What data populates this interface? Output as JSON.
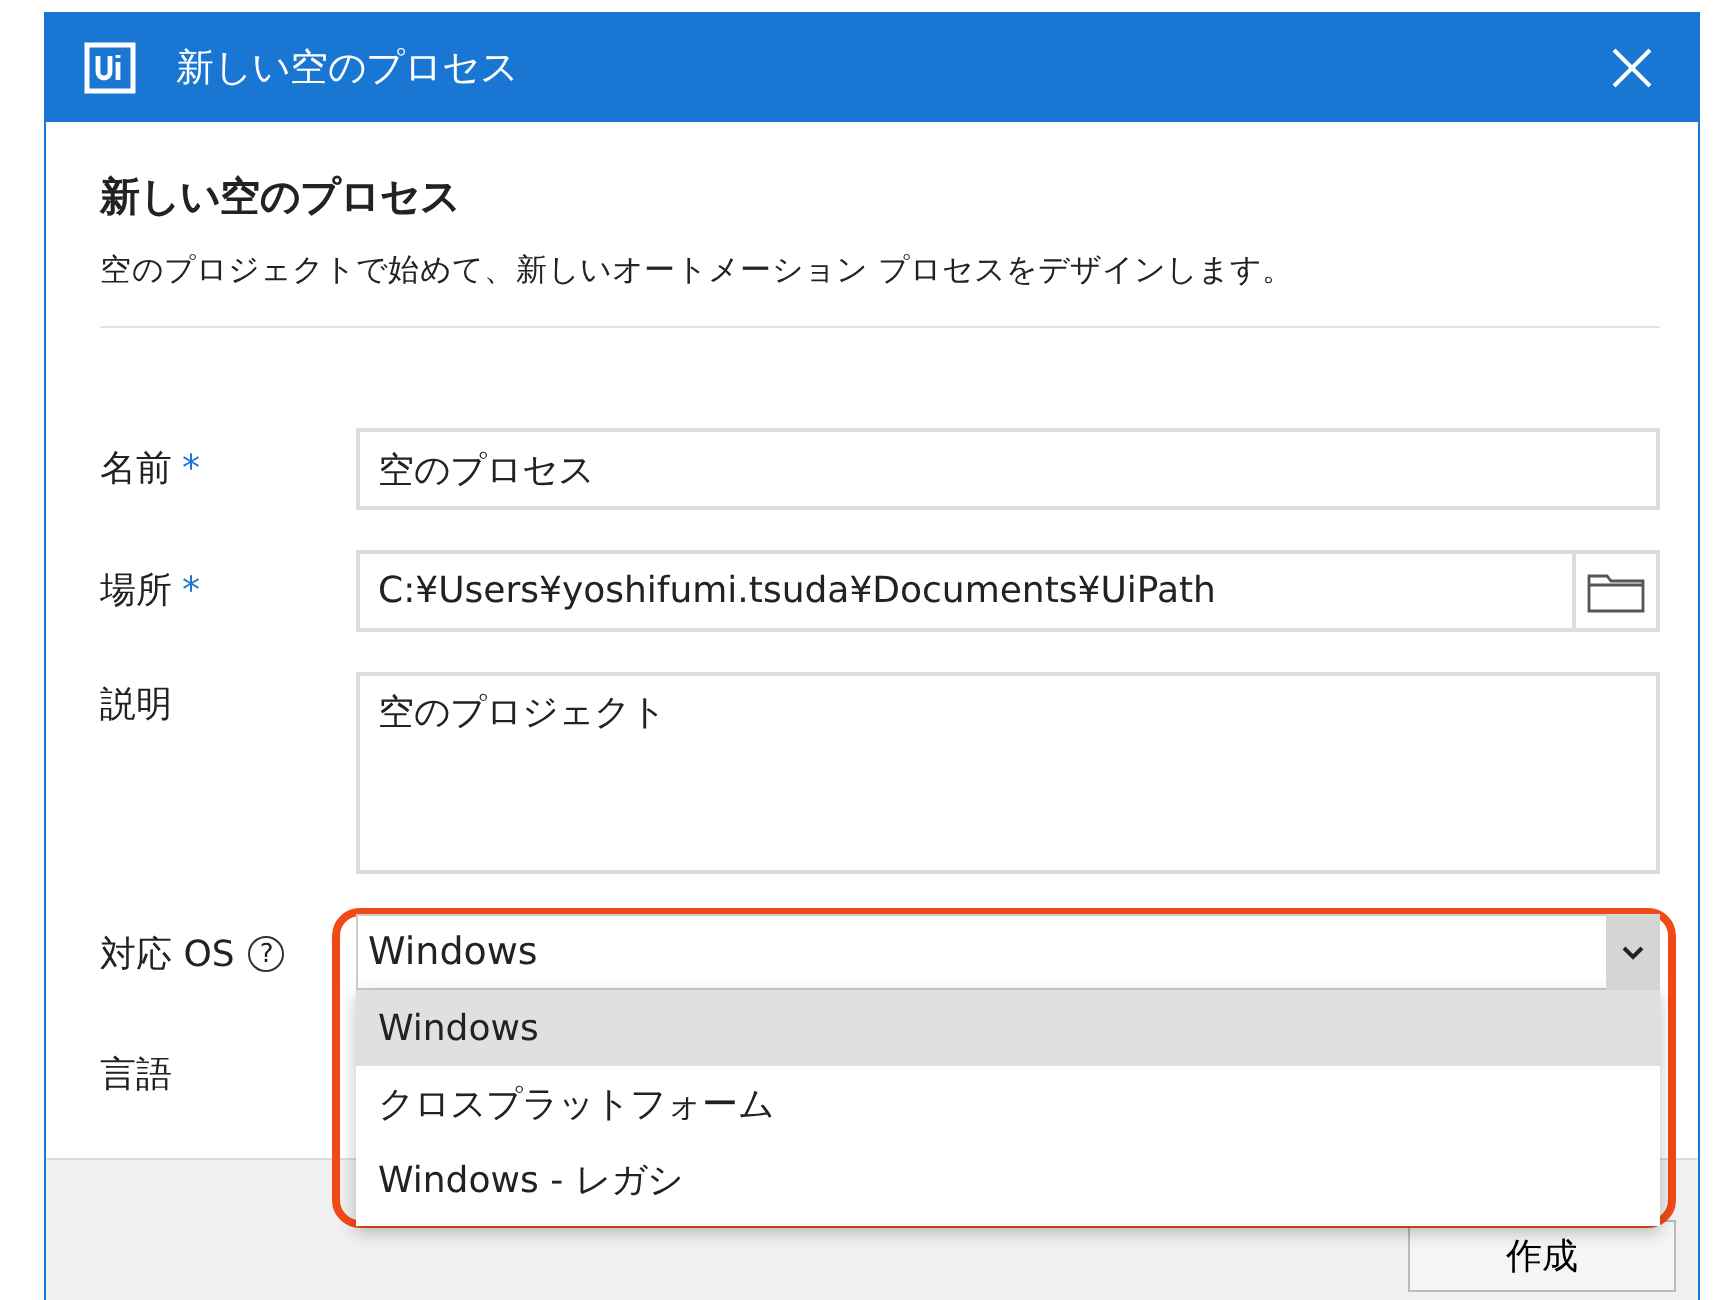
{
  "window": {
    "title": "新しい空のプロセス"
  },
  "heading": "新しい空のプロセス",
  "subtitle": "空のプロジェクトで始めて、新しいオートメーション プロセスをデザインします。",
  "fields": [
    {
      "kind": "text",
      "label": "名前",
      "required_mark": "*",
      "value": "空のプロセス"
    },
    {
      "kind": "path",
      "label": "場所",
      "required_mark": "*",
      "value": "C:¥Users¥yoshifumi.tsuda¥Documents¥UiPath"
    },
    {
      "kind": "textarea",
      "label": "説明",
      "value": "空のプロジェクト"
    },
    {
      "kind": "select",
      "label": "対応 OS",
      "help": "?",
      "value": "Windows",
      "expanded": true,
      "options": [
        {
          "label": "Windows",
          "selected": true
        },
        {
          "label": "クロスプラットフォーム",
          "selected": false
        },
        {
          "label": "Windows - レガシ",
          "selected": false
        }
      ]
    },
    {
      "kind": "hidden",
      "label": "言語"
    }
  ],
  "buttons": [
    "作成"
  ]
}
